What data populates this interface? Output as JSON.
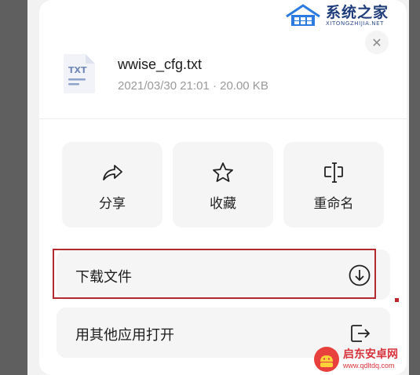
{
  "watermarks": {
    "top_cn": "系统之家",
    "top_en": "XITONGZHIJIA.NET",
    "bottom_cn": "启东安卓网",
    "bottom_en": "www.qdltdq.com"
  },
  "dialog": {
    "close_glyph": "✕",
    "file": {
      "icon_label": "TXT",
      "name": "wwise_cfg.txt",
      "meta": "2021/03/30 21:01 · 20.00 KB"
    },
    "actions": [
      {
        "label": "分享",
        "icon": "share-icon"
      },
      {
        "label": "收藏",
        "icon": "star-icon"
      },
      {
        "label": "重命名",
        "icon": "rename-icon"
      }
    ],
    "menu": [
      {
        "label": "下载文件",
        "icon": "download-icon"
      },
      {
        "label": "用其他应用打开",
        "icon": "open-with-icon"
      }
    ]
  },
  "colors": {
    "highlight_border": "#b4292f",
    "card_bg": "#f5f5f5",
    "backdrop": "#5f5f5f"
  }
}
